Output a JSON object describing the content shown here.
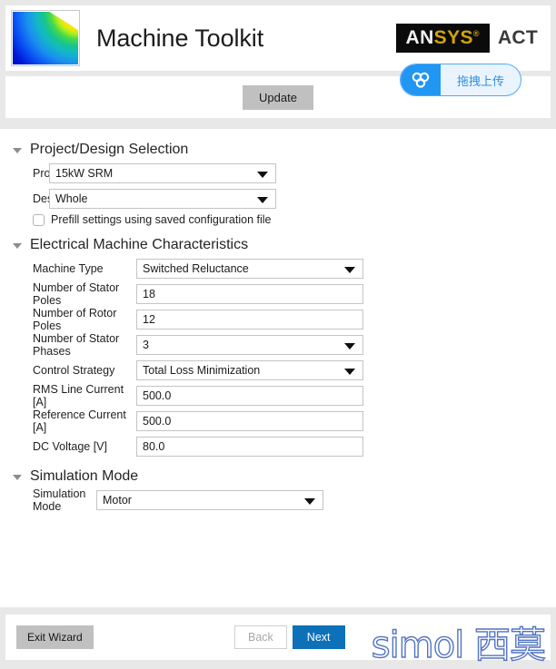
{
  "header": {
    "app_title": "Machine Toolkit",
    "logo_icon": "contour-plot-thumbnail",
    "brand": {
      "ansys_an": "AN",
      "ansys_sys": "SYS",
      "ansys_tm": "®",
      "act": "ACT"
    }
  },
  "upload": {
    "icon": "baidu-netdisk-cloud-icon",
    "label": "拖拽上传"
  },
  "toolbar": {
    "update_label": "Update"
  },
  "sections": [
    {
      "title": "Project/Design Selection",
      "collapse_icon": "triangle-down-icon",
      "rows": [
        {
          "label": "Project",
          "value": "15kW SRM",
          "type": "dropdown"
        },
        {
          "label": "Design",
          "value": "Whole",
          "type": "dropdown"
        }
      ],
      "checkbox": {
        "label": "Prefill settings using saved configuration file",
        "checked": false
      }
    },
    {
      "title": "Electrical Machine Characteristics",
      "collapse_icon": "triangle-down-icon",
      "rows": [
        {
          "label": "Machine Type",
          "value": "Switched Reluctance",
          "type": "dropdown"
        },
        {
          "label": "Number of Stator Poles",
          "value": "18",
          "type": "text"
        },
        {
          "label": "Number of Rotor Poles",
          "value": "12",
          "type": "text"
        },
        {
          "label": "Number of Stator Phases",
          "value": "3",
          "type": "dropdown"
        },
        {
          "label": "Control Strategy",
          "value": "Total Loss Minimization",
          "type": "dropdown"
        },
        {
          "label": "RMS Line Current [A]",
          "value": "500.0",
          "type": "text"
        },
        {
          "label": "Reference Current [A]",
          "value": "500.0",
          "type": "text"
        },
        {
          "label": "DC Voltage [V]",
          "value": "80.0",
          "type": "text"
        }
      ]
    },
    {
      "title": "Simulation Mode",
      "collapse_icon": "triangle-down-icon",
      "rows": [
        {
          "label": "Simulation Mode",
          "value": "Motor",
          "type": "dropdown"
        }
      ]
    }
  ],
  "footer": {
    "exit_wizard_label": "Exit Wizard",
    "back_label": "Back",
    "next_label": "Next",
    "watermark": "simol 西莫"
  },
  "colors": {
    "page_background": "#e8e8e8",
    "panel_background": "#ffffff",
    "accent_blue": "#0d71b9",
    "upload_blue": "#2196f3",
    "button_gray": "#c0c0c0",
    "ansys_gold": "#d2a407",
    "watermark_blue": "#5274c4"
  }
}
